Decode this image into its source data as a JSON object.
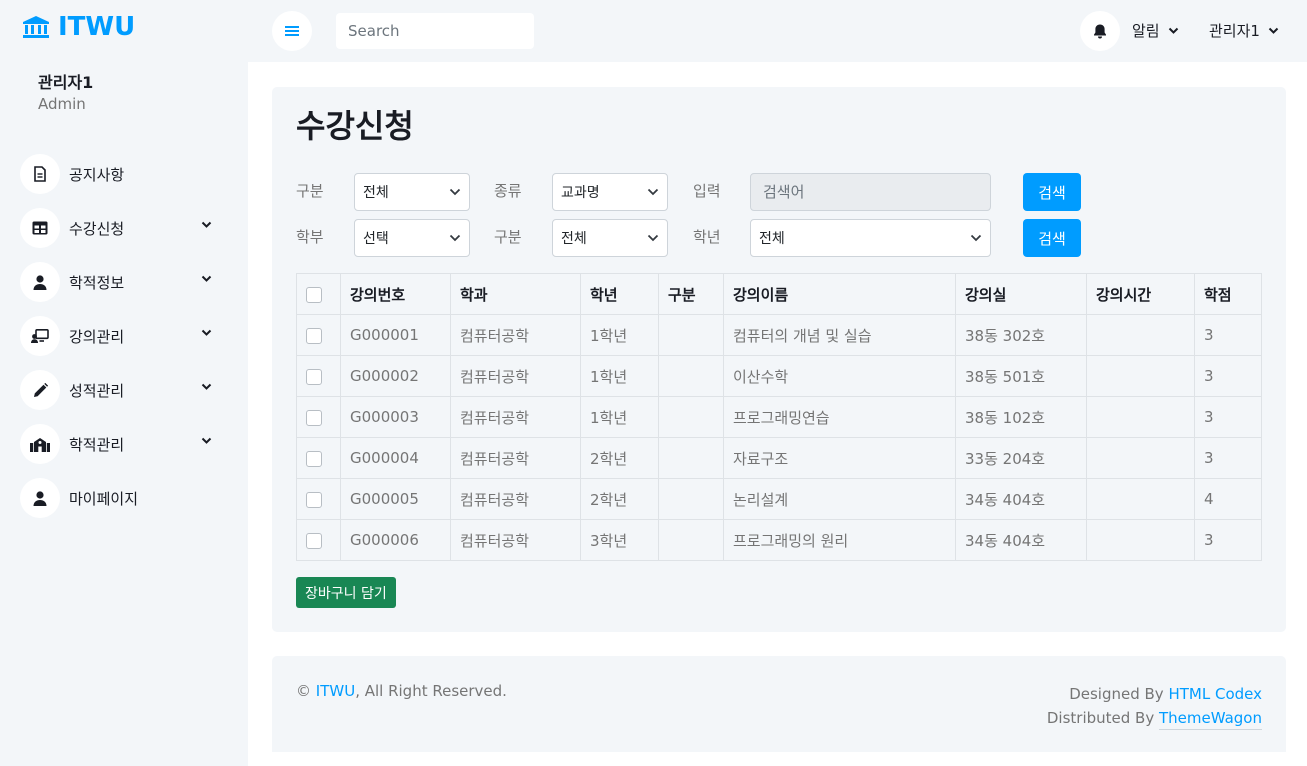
{
  "brand": {
    "name": "ITWU",
    "icon": "university-icon"
  },
  "sidebar": {
    "profile": {
      "name": "관리자1",
      "role": "Admin"
    },
    "items": [
      {
        "label": "공지사항",
        "icon": "document-icon",
        "has_caret": false
      },
      {
        "label": "수강신청",
        "icon": "table-icon",
        "has_caret": true
      },
      {
        "label": "학적정보",
        "icon": "user-icon",
        "has_caret": true
      },
      {
        "label": "강의관리",
        "icon": "chalkboard-teacher-icon",
        "has_caret": true
      },
      {
        "label": "성적관리",
        "icon": "pencil-icon",
        "has_caret": true
      },
      {
        "label": "학적관리",
        "icon": "school-icon",
        "has_caret": true
      },
      {
        "label": "마이페이지",
        "icon": "user-icon",
        "has_caret": false
      }
    ]
  },
  "topbar": {
    "search_placeholder": "Search",
    "notifications_label": "알림",
    "user_label": "관리자1"
  },
  "main": {
    "title": "수강신청",
    "filter_row1": {
      "label1": "구분",
      "select1": "전체",
      "label2": "종류",
      "select2": "교과명",
      "label3": "입력",
      "input_placeholder": "검색어",
      "button": "검색"
    },
    "filter_row2": {
      "label1": "학부",
      "select1": "선택",
      "label2": "구분",
      "select2": "전체",
      "label3": "학년",
      "select3": "전체",
      "button": "검색"
    },
    "table": {
      "headers": [
        "강의번호",
        "학과",
        "학년",
        "구분",
        "강의이름",
        "강의실",
        "강의시간",
        "학점"
      ],
      "rows": [
        [
          "G000001",
          "컴퓨터공학",
          "1학년",
          "",
          "컴퓨터의 개념 및 실습",
          "38동 302호",
          "",
          "3"
        ],
        [
          "G000002",
          "컴퓨터공학",
          "1학년",
          "",
          "이산수학",
          "38동 501호",
          "",
          "3"
        ],
        [
          "G000003",
          "컴퓨터공학",
          "1학년",
          "",
          "프로그래밍연습",
          "38동 102호",
          "",
          "3"
        ],
        [
          "G000004",
          "컴퓨터공학",
          "2학년",
          "",
          "자료구조",
          "33동 204호",
          "",
          "3"
        ],
        [
          "G000005",
          "컴퓨터공학",
          "2학년",
          "",
          "논리설계",
          "34동 404호",
          "",
          "4"
        ],
        [
          "G000006",
          "컴퓨터공학",
          "3학년",
          "",
          "프로그래밍의 원리",
          "34동 404호",
          "",
          "3"
        ]
      ]
    },
    "cart_button": "장바구니 담기"
  },
  "footer": {
    "copyright_prefix": "©",
    "brand_link": "ITWU",
    "copyright_suffix": ", All Right Reserved.",
    "designed_by": "Designed By",
    "designer_link": "HTML Codex",
    "distributed_by": "Distributed By",
    "distributor_link": "ThemeWagon"
  },
  "colors": {
    "primary": "#009cff",
    "secondary_bg": "#f3f6f9",
    "dark": "#191c24",
    "success": "#198754"
  }
}
